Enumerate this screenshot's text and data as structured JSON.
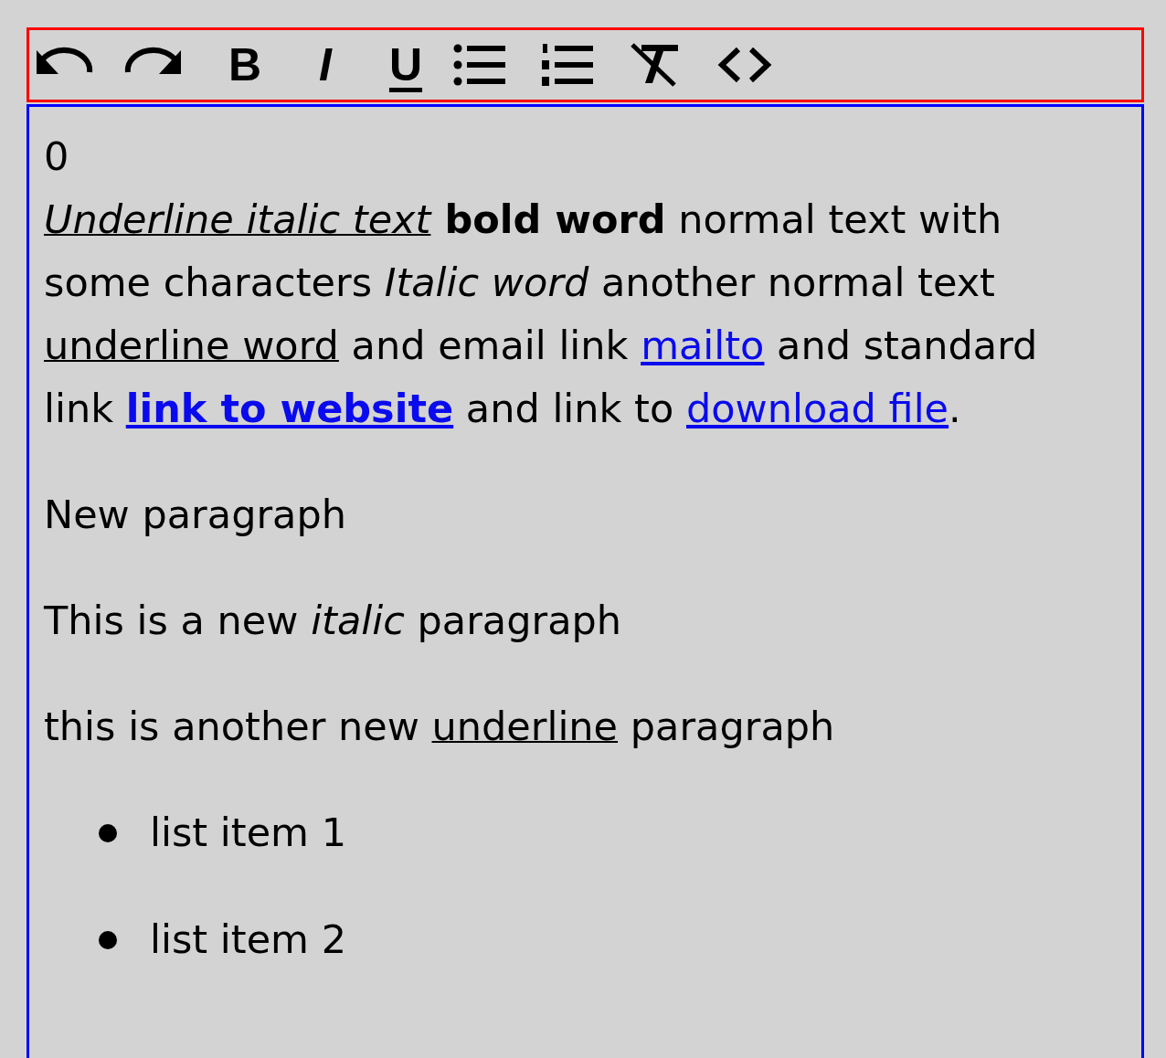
{
  "toolbar": [
    {
      "kind": "undo"
    },
    {
      "kind": "redo"
    },
    {
      "kind": "bold",
      "label": "B"
    },
    {
      "kind": "italic",
      "label": "I"
    },
    {
      "kind": "underline",
      "label": "U"
    },
    {
      "kind": "bullets"
    },
    {
      "kind": "numbers"
    },
    {
      "kind": "clear"
    },
    {
      "kind": "code"
    }
  ],
  "editor": {
    "blocks": [
      {
        "kind": "line",
        "segments": [
          {
            "kind": "text",
            "text": "0"
          }
        ]
      },
      {
        "kind": "paragraph",
        "segments": [
          {
            "kind": "underline-italic",
            "text": "Underline italic text"
          },
          {
            "kind": "bold",
            "text": " bold word"
          },
          {
            "kind": "text",
            "text": " normal text with some characters "
          },
          {
            "kind": "italic",
            "text": "Italic word"
          },
          {
            "kind": "text",
            "text": " another normal text "
          },
          {
            "kind": "underline",
            "text": "underline word"
          },
          {
            "kind": "text",
            "text": " and email link "
          },
          {
            "kind": "link",
            "text": "mailto"
          },
          {
            "kind": "text",
            "text": " and standard link "
          },
          {
            "kind": "bold-link",
            "text": "link to website"
          },
          {
            "kind": "text",
            "text": " and link to "
          },
          {
            "kind": "link",
            "text": "download file"
          },
          {
            "kind": "text",
            "text": "."
          }
        ]
      },
      {
        "kind": "paragraph",
        "segments": [
          {
            "kind": "text",
            "text": "New paragraph"
          }
        ]
      },
      {
        "kind": "paragraph",
        "segments": [
          {
            "kind": "text",
            "text": "This is a new "
          },
          {
            "kind": "italic",
            "text": "italic"
          },
          {
            "kind": "text",
            "text": " paragraph"
          }
        ]
      },
      {
        "kind": "paragraph",
        "segments": [
          {
            "kind": "text",
            "text": "this is another new "
          },
          {
            "kind": "underline",
            "text": "underline"
          },
          {
            "kind": "text",
            "text": " paragraph"
          }
        ]
      },
      {
        "kind": "list",
        "items": [
          "list item 1",
          "list item 2"
        ]
      }
    ]
  }
}
